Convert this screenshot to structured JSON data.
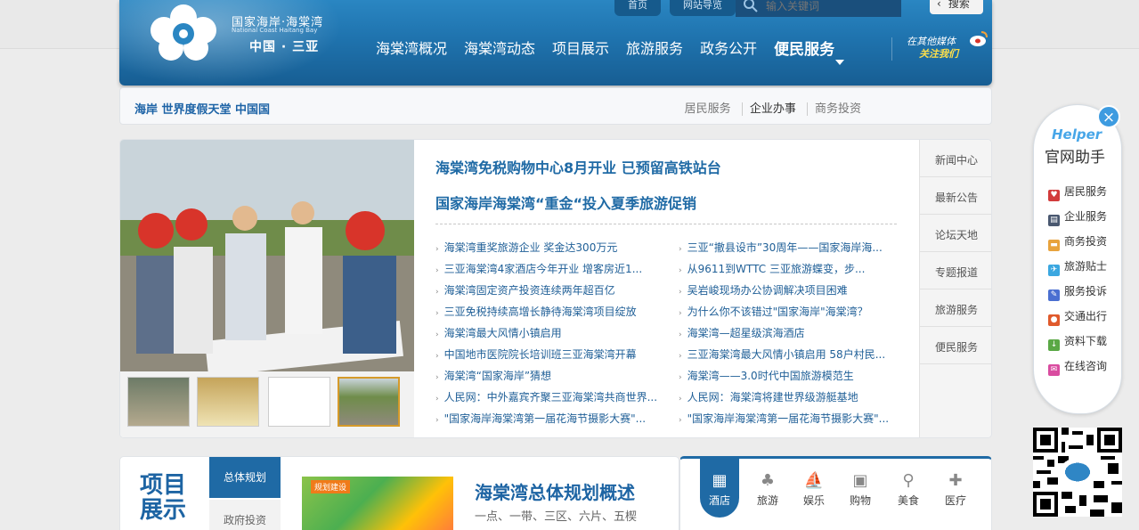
{
  "header": {
    "logo_cn": "国家海岸·海棠湾",
    "logo_en": "National Coast Haitang Bay",
    "logo_location": "中国 · 三亚",
    "util_home": "首页",
    "util_nav": "网站导览",
    "search_placeholder": "输入关键词",
    "search_button": "搜索",
    "nav": [
      "海棠湾概况",
      "海棠湾动态",
      "项目展示",
      "旅游服务",
      "政务公开",
      "便民服务"
    ],
    "follow_line1": "在其他媒体",
    "follow_line2": "关注我们"
  },
  "subbar": {
    "slogan": "海岸 世界度假天堂   中国国",
    "links": [
      "居民服务",
      "企业办事",
      "商务投资"
    ]
  },
  "news": {
    "headlines": [
      "海棠湾免税购物中心8月开业 已预留高铁站台",
      "国家海岸海棠湾“重金“投入夏季旅游促销"
    ],
    "left_list": [
      "海棠湾重奖旅游企业 奖金达300万元",
      "三亚海棠湾4家酒店今年开业 增客房近1...",
      "海棠湾固定资产投资连续两年超百亿",
      "三亚免税持续高增长静待海棠湾项目绽放",
      "海棠湾最大风情小镇启用",
      "中国地市医院院长培训班三亚海棠湾开幕",
      "海棠湾“国家海岸”猜想",
      "人民网：中外嘉宾齐聚三亚海棠湾共商世界...",
      "\"国家海岸海棠湾第一届花海节摄影大赛\"..."
    ],
    "right_list": [
      "三亚“撤县设市”30周年——国家海岸海...",
      "从9611到WTTC 三亚旅游蝶变，步...",
      "吴岩峻现场办公协调解决项目困难",
      "为什么你不该错过\"国家海岸\"海棠湾？",
      "海棠湾—超星级滨海酒店",
      "三亚海棠湾最大风情小镇启用 58户村民...",
      "海棠湾——3.0时代中国旅游模范生",
      "人民网：海棠湾将建世界级游艇基地",
      "\"国家海岸海棠湾第一届花海节摄影大赛\"..."
    ],
    "side_tabs": [
      "新闻中心",
      "最新公告",
      "论坛天地",
      "专题报道",
      "旅游服务",
      "便民服务"
    ]
  },
  "project": {
    "title_line1": "项目",
    "title_line2": "展示",
    "tab_active": "总体规划",
    "tab_inactive": "政府投资",
    "image_tag": "规划建设",
    "heading": "海棠湾总体规划概述",
    "subtitle": "一点、一带、三区、六片、五楔"
  },
  "services": {
    "items": [
      {
        "label": "酒店",
        "icon": "hotel-icon"
      },
      {
        "label": "旅游",
        "icon": "palm-icon"
      },
      {
        "label": "娱乐",
        "icon": "sailboat-icon"
      },
      {
        "label": "购物",
        "icon": "bag-icon"
      },
      {
        "label": "美食",
        "icon": "cutlery-icon"
      },
      {
        "label": "医疗",
        "icon": "medical-icon"
      }
    ]
  },
  "helper": {
    "title_en": "Helper",
    "title_cn": "官网助手",
    "items": [
      {
        "label": "居民服务",
        "color": "#d23b3b"
      },
      {
        "label": "企业服务",
        "color": "#4a5870"
      },
      {
        "label": "商务投资",
        "color": "#e8a33d"
      },
      {
        "label": "旅游贴士",
        "color": "#3ba7e0"
      },
      {
        "label": "服务投诉",
        "color": "#4a6fd1"
      },
      {
        "label": "交通出行",
        "color": "#e05a2c"
      },
      {
        "label": "资料下载",
        "color": "#5aa845"
      },
      {
        "label": "在线咨询",
        "color": "#d94ca0"
      }
    ]
  },
  "colors": {
    "primary": "#1f6aa5",
    "accent": "#ffe04a"
  }
}
